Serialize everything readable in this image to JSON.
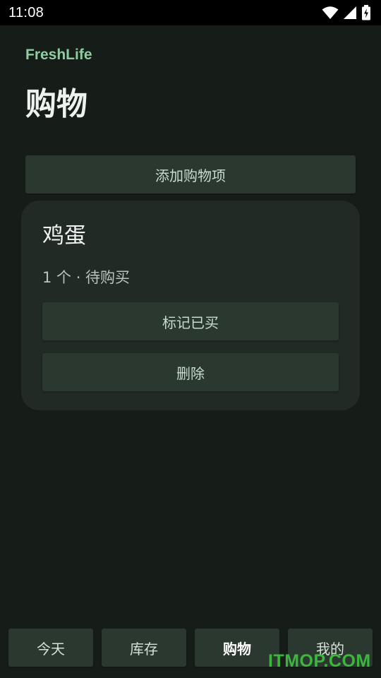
{
  "status_bar": {
    "time": "11:08",
    "icons": [
      "wifi-icon",
      "signal-icon",
      "battery-charging-icon"
    ]
  },
  "app": {
    "name": "FreshLife",
    "page_title": "购物"
  },
  "actions": {
    "add_label": "添加购物项"
  },
  "shopping_items": [
    {
      "name": "鸡蛋",
      "meta": "1 个 · 待购买",
      "mark_label": "标记已买",
      "delete_label": "删除"
    }
  ],
  "bottom_nav": {
    "items": [
      {
        "label": "今天"
      },
      {
        "label": "库存"
      },
      {
        "label": "购物"
      },
      {
        "label": "我的"
      }
    ],
    "active": "购物"
  },
  "watermark": "ITMOP.COM",
  "colors": {
    "background": "#161d19",
    "card": "#212a25",
    "button": "#2a3830",
    "accent": "#8fcca0",
    "watermark": "#3fc13f"
  }
}
